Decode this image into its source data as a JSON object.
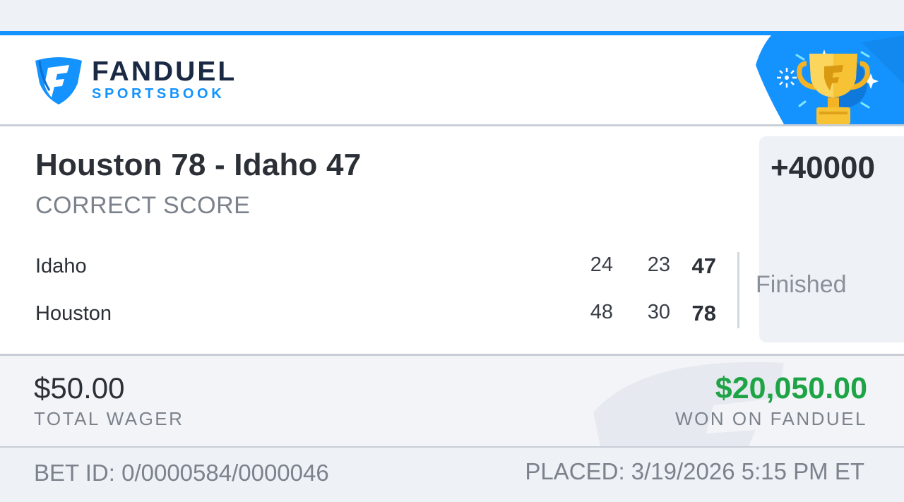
{
  "brand": {
    "name": "FANDUEL",
    "subtitle": "SPORTSBOOK",
    "primary_color": "#1493ff",
    "dark_color": "#1a2a44",
    "icons": [
      "fanduel-shield-icon",
      "trophy-icon"
    ]
  },
  "bet": {
    "selection": "Houston 78 - Idaho 47",
    "market": "CORRECT SCORE",
    "odds": "+40000",
    "status": "Finished"
  },
  "scoreboard": {
    "teams": [
      {
        "name": "Idaho",
        "period1": "24",
        "period2": "23",
        "total": "47"
      },
      {
        "name": "Houston",
        "period1": "48",
        "period2": "30",
        "total": "78"
      }
    ]
  },
  "wager": {
    "amount": "$50.00",
    "label": "TOTAL WAGER",
    "won_amount": "$20,050.00",
    "won_label": "WON ON FANDUEL",
    "won_color": "#1ea446"
  },
  "footer": {
    "bet_id": "BET ID: 0/0000584/0000046",
    "placed": "PLACED: 3/19/2026 5:15 PM ET"
  }
}
